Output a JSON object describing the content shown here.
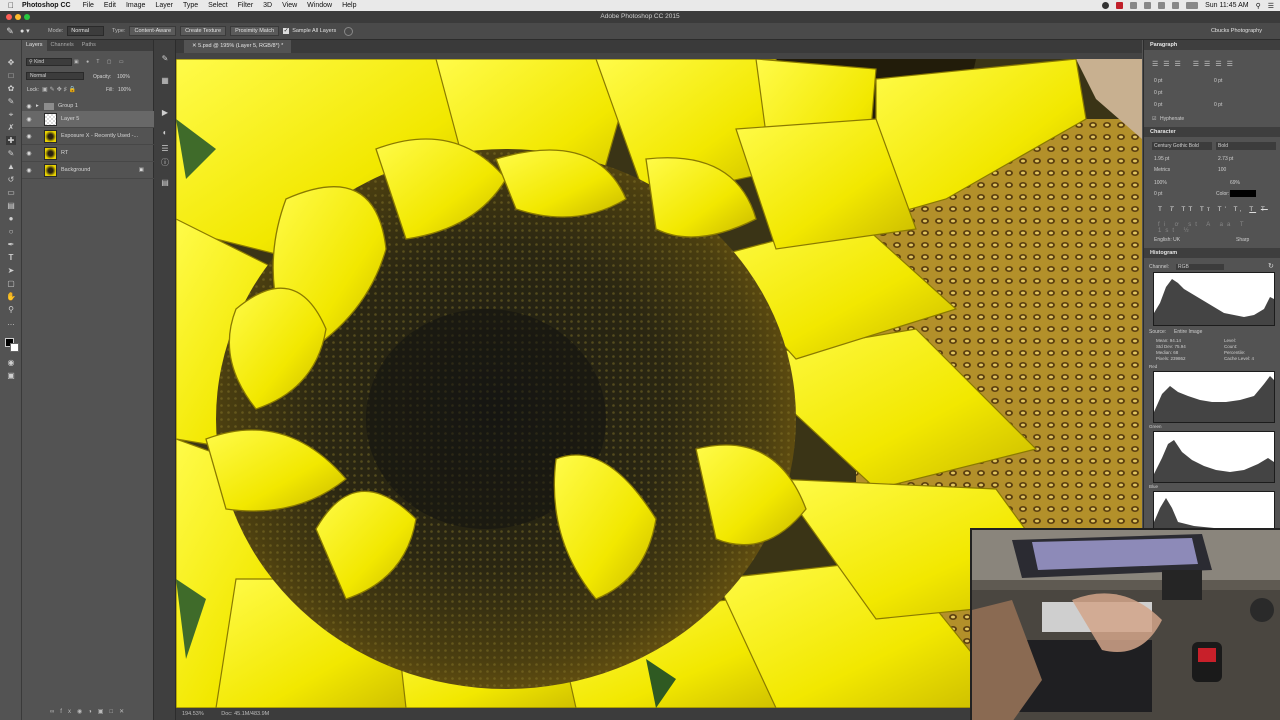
{
  "menubar": {
    "app_name": "Photoshop CC",
    "items": [
      "File",
      "Edit",
      "Image",
      "Layer",
      "Type",
      "Select",
      "Filter",
      "3D",
      "View",
      "Window",
      "Help"
    ],
    "clock": "Sun 11:45 AM"
  },
  "window": {
    "title": "Adobe Photoshop CC 2015",
    "workspace": "Cbucks Photography"
  },
  "options_bar": {
    "mode_label": "Mode:",
    "mode_value": "Normal",
    "type_label": "Type:",
    "type_buttons": [
      "Content-Aware",
      "Create Texture",
      "Proximity Match"
    ],
    "sample_all_layers": "Sample All Layers"
  },
  "layers_panel": {
    "tabs": [
      "Layers",
      "Channels",
      "Paths"
    ],
    "filter_kind": "Kind",
    "blend_mode": "Normal",
    "opacity_label": "Opacity:",
    "opacity_value": "100%",
    "lock_label": "Lock:",
    "fill_label": "Fill:",
    "fill_value": "100%",
    "layers": [
      {
        "name": "Group 1",
        "kind": "group",
        "visible": true
      },
      {
        "name": "Layer 5",
        "kind": "pixel",
        "visible": true,
        "selected": true
      },
      {
        "name": "Exposure X - Recently Used -...",
        "kind": "smart",
        "visible": true
      },
      {
        "name": "RT",
        "kind": "smart",
        "visible": true
      },
      {
        "name": "Background",
        "kind": "smart",
        "visible": true,
        "locked": true
      }
    ]
  },
  "document": {
    "tab_title": "5.psd @ 195% (Layer 5, RGB/8*) *",
    "zoom": "194.53%",
    "doc_size": "Doc: 45.1M/483.9M"
  },
  "paragraph_panel": {
    "title": "Paragraph",
    "fields": [
      "0 pt",
      "0 pt",
      "0 pt",
      "0 pt",
      "0 pt"
    ],
    "hyphenate": "Hyphenate"
  },
  "character_panel": {
    "title": "Character",
    "font": "Century Gothic Bold",
    "style": "Bold",
    "size": "1.95 pt",
    "leading": "2.73 pt",
    "kerning": "Metrics",
    "tracking": "100",
    "vscale": "100%",
    "hscale": "69%",
    "baseline": "0 pt",
    "color_label": "Color:",
    "language": "English: UK",
    "antialias": "Sharp"
  },
  "histogram_panel": {
    "title": "Histogram",
    "channel_label": "Channel:",
    "channel_value": "RGB",
    "source_label": "Source:",
    "source_value": "Entire Image",
    "stats_left": [
      "Mean: 94.14",
      "Std Dev: 75.94",
      "Median: 68",
      "Pixels: 239862"
    ],
    "stats_right": [
      "Level:",
      "Count:",
      "Percentile:",
      "Cache Level: 4"
    ],
    "channels": [
      "Red",
      "Green",
      "Blue"
    ]
  }
}
